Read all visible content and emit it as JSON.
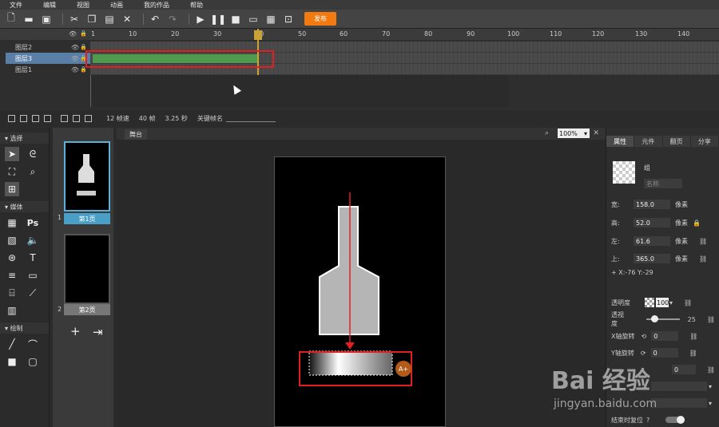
{
  "menu": [
    "文件",
    "编辑",
    "视图",
    "动画",
    "我的作品",
    "帮助"
  ],
  "toolbar": {
    "publish_label": "发布"
  },
  "timeline": {
    "ruler_numbers": [
      "1",
      "10",
      "20",
      "30",
      "40",
      "50",
      "60",
      "70",
      "80",
      "90",
      "100",
      "110",
      "120",
      "130",
      "140"
    ],
    "layers": [
      {
        "name": "图层2",
        "selected": false
      },
      {
        "name": "图层3",
        "selected": true
      },
      {
        "name": "图层1",
        "selected": false
      }
    ],
    "fps": "12 帧速",
    "frames": "40 帧",
    "duration": "3.25 秒",
    "keyframe_name_label": "关键帧名"
  },
  "tools": {
    "select_header": "选择",
    "media_header": "媒体",
    "draw_header": "绘制",
    "ps_label": "Ps"
  },
  "pages": [
    {
      "num": "1",
      "label": "第1页",
      "selected": true
    },
    {
      "num": "2",
      "label": "第2页",
      "selected": false
    }
  ],
  "canvas": {
    "tab_label": "舞台",
    "zoom": "100%"
  },
  "props": {
    "tabs": [
      "属性",
      "元件",
      "翻页",
      "分享"
    ],
    "object_name": "组",
    "name_placeholder": "名称",
    "width_label": "宽:",
    "width_value": "158.0",
    "height_label": "高:",
    "height_value": "52.0",
    "left_label": "左:",
    "left_value": "61.6",
    "top_label": "上:",
    "top_value": "365.0",
    "unit": "像素",
    "coord": "+  X:-76      Y:-29",
    "opacity_label": "透明度",
    "opacity_value": "100",
    "perspective_label": "透视度",
    "perspective_value": "25",
    "xrot_label": "X轴旋转",
    "xrot_value": "0",
    "yrot_label": "Y轴旋转",
    "yrot_value": "0",
    "zrot_value": "0",
    "reset_label": "结束时复位",
    "colors": {
      "accent": "#f27a10",
      "selected": "#4a9fc7",
      "highlight": "#e02020",
      "track": "#4f9a4f"
    }
  },
  "watermark": {
    "logo": "Bai 经验",
    "url": "jingyan.baidu.com"
  }
}
